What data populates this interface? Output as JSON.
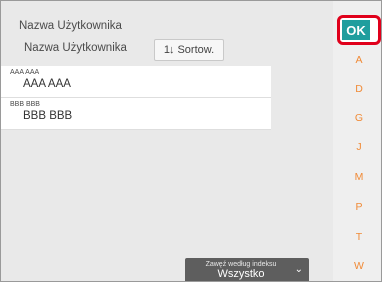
{
  "panel": {
    "title": "Nazwa Użytkownika",
    "column_header": "Nazwa Użytkownika",
    "sort_button": "Sortow.",
    "sort_icon": "1↓"
  },
  "rows": [
    {
      "small": "AAA AAA",
      "big": "AAA AAA"
    },
    {
      "small": "BBB BBB",
      "big": "BBB BBB"
    }
  ],
  "ok_button": "OK",
  "index_letters": [
    "A",
    "D",
    "G",
    "J",
    "M",
    "P",
    "T",
    "W"
  ],
  "filter": {
    "label": "Zawęź według indeksu",
    "value": "Wszystko",
    "chevron_icon": "chevron-down-icon"
  },
  "colors": {
    "ok_bg": "#1f9e9e",
    "ok_border": "#e0001b",
    "index_letter": "#f08a36"
  }
}
